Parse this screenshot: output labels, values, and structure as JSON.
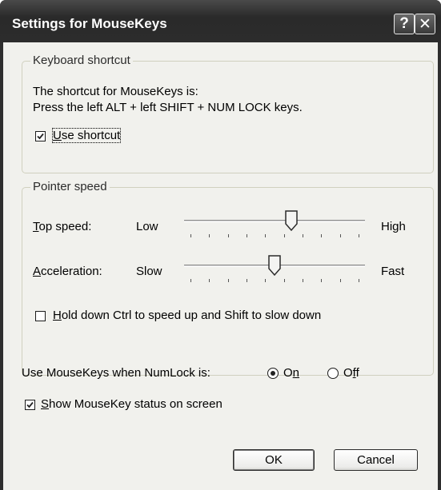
{
  "window": {
    "title": "Settings for MouseKeys",
    "help_glyph": "?",
    "close_glyph": "✕"
  },
  "keyboard_shortcut": {
    "legend": "Keyboard shortcut",
    "line1": "The shortcut for MouseKeys is:",
    "line2": "Press the left ALT + left SHIFT + NUM LOCK keys.",
    "use_shortcut": {
      "mnemonic": "U",
      "rest": "se shortcut",
      "checked": true
    }
  },
  "pointer_speed": {
    "legend": "Pointer speed",
    "top_speed": {
      "mnemonic": "T",
      "rest": "op speed:",
      "low": "Low",
      "high": "High",
      "level": 0.6
    },
    "acceleration": {
      "mnemonic": "A",
      "rest": "cceleration:",
      "low": "Slow",
      "high": "Fast",
      "level": 0.5
    },
    "hold_ctrl": {
      "mnemonic": "H",
      "rest": "old down Ctrl to speed up and Shift to slow down",
      "checked": false
    }
  },
  "numlock": {
    "label": "Use MouseKeys when NumLock is:",
    "on": {
      "before": "O",
      "mnemonic": "n",
      "selected": true
    },
    "off": {
      "before": "O",
      "mnemonic": "f",
      "after": "f",
      "selected": false
    }
  },
  "status": {
    "mnemonic": "S",
    "rest": "how MouseKey status on screen",
    "checked": true
  },
  "buttons": {
    "ok": "OK",
    "cancel": "Cancel"
  },
  "colors": {
    "titlebar": "#2c2c2c",
    "dialog_bg": "#f1f1ed",
    "group_border": "#d0d0bf"
  }
}
